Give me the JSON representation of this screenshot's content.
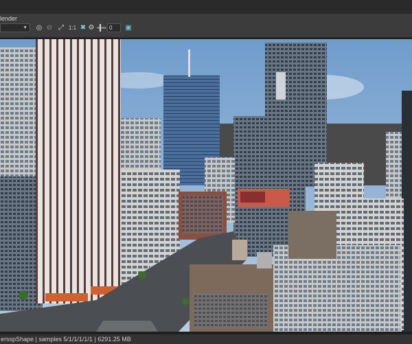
{
  "toolbar": {
    "renderer_label": "lender",
    "renderer_value": "",
    "ratio_label": "1:1",
    "exposure_value": "0"
  },
  "icons": {
    "render": "render-icon",
    "stop": "stop-icon",
    "region": "region-icon",
    "color_correct": "color-correct-icon",
    "settings": "gear-icon",
    "save": "save-icon"
  },
  "viewport": {
    "billboard_text": "",
    "sky_color": "#8ab0d6"
  },
  "status": {
    "text": "ersspShape | samples 5/1/1/1/1/1 | 6291.25 MB"
  }
}
